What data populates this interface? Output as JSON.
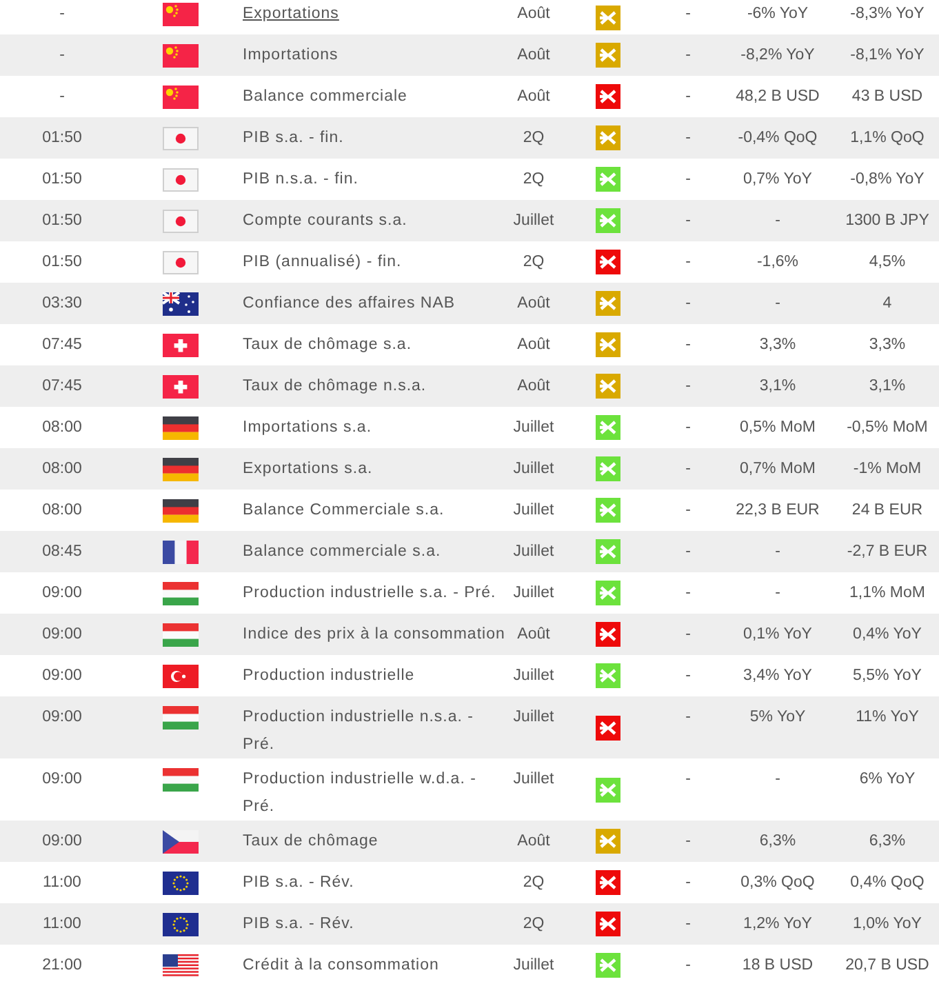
{
  "rows": [
    {
      "column_1": "-",
      "kind": "cn",
      "column_3": "Exportations",
      "hovered": true,
      "column_4": "Août",
      "color": "#d9a900",
      "column_6": "-",
      "column_7": "-6% YoY",
      "column_8": "-8,3% YoY"
    },
    {
      "column_1": "-",
      "kind": "cn",
      "column_3": "Importations",
      "hovered": false,
      "column_4": "Août",
      "color": "#d9a900",
      "column_6": "-",
      "column_7": "-8,2% YoY",
      "column_8": "-8,1% YoY"
    },
    {
      "column_1": "-",
      "kind": "cn",
      "column_3": "Balance commerciale",
      "hovered": false,
      "column_4": "Août",
      "color": "#ee0a0a",
      "column_6": "-",
      "column_7": "48,2 B USD",
      "column_8": "43 B USD"
    },
    {
      "column_1": "01:50",
      "kind": "jp",
      "column_3": "PIB s.a. - fin.",
      "hovered": false,
      "column_4": "2Q",
      "color": "#d9a900",
      "column_6": "-",
      "column_7": "-0,4% QoQ",
      "column_8": "1,1% QoQ"
    },
    {
      "column_1": "01:50",
      "kind": "jp",
      "column_3": "PIB n.s.a. - fin.",
      "hovered": false,
      "column_4": "2Q",
      "color": "#6ce23c",
      "column_6": "-",
      "column_7": "0,7% YoY",
      "column_8": "-0,8% YoY"
    },
    {
      "column_1": "01:50",
      "kind": "jp",
      "column_3": "Compte courants s.a.",
      "hovered": false,
      "column_4": "Juillet",
      "color": "#6ce23c",
      "column_6": "-",
      "column_7": "-",
      "column_8": "1300 B JPY"
    },
    {
      "column_1": "01:50",
      "kind": "jp",
      "column_3": "PIB (annualisé) - fin.",
      "hovered": false,
      "column_4": "2Q",
      "color": "#ee0a0a",
      "column_6": "-",
      "column_7": "-1,6%",
      "column_8": "4,5%"
    },
    {
      "column_1": "03:30",
      "kind": "au",
      "column_3": "Confiance des affaires NAB",
      "hovered": false,
      "column_4": "Août",
      "color": "#d9a900",
      "column_6": "-",
      "column_7": "-",
      "column_8": "4"
    },
    {
      "column_1": "07:45",
      "kind": "ch",
      "column_3": "Taux de chômage s.a.",
      "hovered": false,
      "column_4": "Août",
      "color": "#d9a900",
      "column_6": "-",
      "column_7": "3,3%",
      "column_8": "3,3%"
    },
    {
      "column_1": "07:45",
      "kind": "ch",
      "column_3": "Taux de chômage n.s.a.",
      "hovered": false,
      "column_4": "Août",
      "color": "#d9a900",
      "column_6": "-",
      "column_7": "3,1%",
      "column_8": "3,1%"
    },
    {
      "column_1": "08:00",
      "kind": "de",
      "column_3": "Importations s.a.",
      "hovered": false,
      "column_4": "Juillet",
      "color": "#6ce23c",
      "column_6": "-",
      "column_7": "0,5% MoM",
      "column_8": "-0,5% MoM"
    },
    {
      "column_1": "08:00",
      "kind": "de",
      "column_3": "Exportations s.a.",
      "hovered": false,
      "column_4": "Juillet",
      "color": "#6ce23c",
      "column_6": "-",
      "column_7": "0,7% MoM",
      "column_8": "-1% MoM"
    },
    {
      "column_1": "08:00",
      "kind": "de",
      "column_3": "Balance Commerciale s.a.",
      "hovered": false,
      "column_4": "Juillet",
      "color": "#6ce23c",
      "column_6": "-",
      "column_7": "22,3 B EUR",
      "column_8": "24 B EUR"
    },
    {
      "column_1": "08:45",
      "kind": "fr",
      "column_3": "Balance commerciale s.a.",
      "hovered": false,
      "column_4": "Juillet",
      "color": "#6ce23c",
      "column_6": "-",
      "column_7": "-",
      "column_8": "-2,7 B EUR"
    },
    {
      "column_1": "09:00",
      "kind": "hu",
      "column_3": "Production industrielle s.a. - Pré.",
      "hovered": false,
      "column_4": "Juillet",
      "color": "#6ce23c",
      "column_6": "-",
      "column_7": "-",
      "column_8": "1,1% MoM"
    },
    {
      "column_1": "09:00",
      "kind": "hu",
      "column_3": "Indice des prix à la consommation",
      "hovered": false,
      "column_4": "Août",
      "color": "#ee0a0a",
      "column_6": "-",
      "column_7": "0,1% YoY",
      "column_8": "0,4% YoY"
    },
    {
      "column_1": "09:00",
      "kind": "tr",
      "column_3": "Production industrielle",
      "hovered": false,
      "column_4": "Juillet",
      "color": "#6ce23c",
      "column_6": "-",
      "column_7": "3,4% YoY",
      "column_8": "5,5% YoY"
    },
    {
      "column_1": "09:00",
      "kind": "hu",
      "column_3": "Production industrielle n.s.a. - Pré.",
      "hovered": false,
      "column_4": "Juillet",
      "color": "#ee0a0a",
      "column_6": "-",
      "column_7": "5% YoY",
      "column_8": "11% YoY"
    },
    {
      "column_1": "09:00",
      "kind": "hu",
      "column_3": "Production industrielle w.d.a. - Pré.",
      "hovered": false,
      "column_4": "Juillet",
      "color": "#6ce23c",
      "column_6": "-",
      "column_7": "-",
      "column_8": "6% YoY"
    },
    {
      "column_1": "09:00",
      "kind": "cz",
      "column_3": "Taux de chômage",
      "hovered": false,
      "column_4": "Août",
      "color": "#d9a900",
      "column_6": "-",
      "column_7": "6,3%",
      "column_8": "6,3%"
    },
    {
      "column_1": "11:00",
      "kind": "eu",
      "column_3": "PIB s.a. - Rév.",
      "hovered": false,
      "column_4": "2Q",
      "color": "#ee0a0a",
      "column_6": "-",
      "column_7": "0,3% QoQ",
      "column_8": "0,4% QoQ"
    },
    {
      "column_1": "11:00",
      "kind": "eu",
      "column_3": "PIB s.a. - Rév.",
      "hovered": false,
      "column_4": "2Q",
      "color": "#ee0a0a",
      "column_6": "-",
      "column_7": "1,2% YoY",
      "column_8": "1,0% YoY"
    },
    {
      "column_1": "21:00",
      "kind": "us",
      "column_3": "Crédit à la consommation",
      "hovered": false,
      "column_4": "Juillet",
      "color": "#6ce23c",
      "column_6": "-",
      "column_7": "18 B USD",
      "column_8": "20,7 B USD"
    }
  ]
}
